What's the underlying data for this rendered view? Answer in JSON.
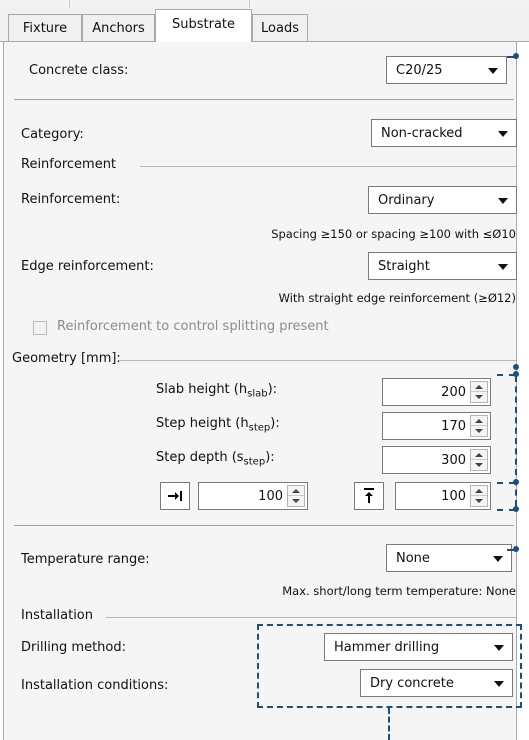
{
  "tabs": [
    {
      "label": "Fixture"
    },
    {
      "label": "Anchors"
    },
    {
      "label": "Substrate"
    },
    {
      "label": "Loads"
    }
  ],
  "concrete": {
    "label": "Concrete class:",
    "value": "C20/25"
  },
  "category": {
    "label": "Category:",
    "value": "Non-cracked"
  },
  "reinforcement_section": {
    "title": "Reinforcement"
  },
  "reinforcement": {
    "label": "Reinforcement:",
    "value": "Ordinary",
    "note": "Spacing ≥150 or spacing ≥100 with ≤Ø10"
  },
  "edge_reinforcement": {
    "label": "Edge reinforcement:",
    "value": "Straight",
    "note": "With straight edge reinforcement (≥Ø12)"
  },
  "splitting": {
    "label": "Reinforcement to control splitting present",
    "checked": false,
    "enabled": false
  },
  "geometry": {
    "title": "Geometry [mm]:",
    "slab_height": {
      "label_main": "Slab height (h",
      "label_sub": "slab",
      "label_end": "):",
      "value": "200"
    },
    "step_height": {
      "label_main": "Step height (h",
      "label_sub": "step",
      "label_end": "):",
      "value": "170"
    },
    "step_depth": {
      "label_main": "Step depth (s",
      "label_sub": "step",
      "label_end": "):",
      "value": "300"
    },
    "edge_distance_x": {
      "value": "100",
      "icon": "arrow-right-to-bar-icon"
    },
    "edge_distance_y": {
      "value": "100",
      "icon": "arrow-up-to-bar-icon"
    }
  },
  "temperature": {
    "label": "Temperature range:",
    "value": "None",
    "note": "Max. short/long term temperature: None"
  },
  "installation_section": {
    "title": "Installation"
  },
  "drilling": {
    "label": "Drilling method:",
    "value": "Hammer drilling"
  },
  "conditions": {
    "label": "Installation conditions:",
    "value": "Dry concrete"
  },
  "colors": {
    "annotation": "#1f4e79",
    "panel_bg": "#f5f5f5",
    "tab_border": "#a9a9a9"
  }
}
